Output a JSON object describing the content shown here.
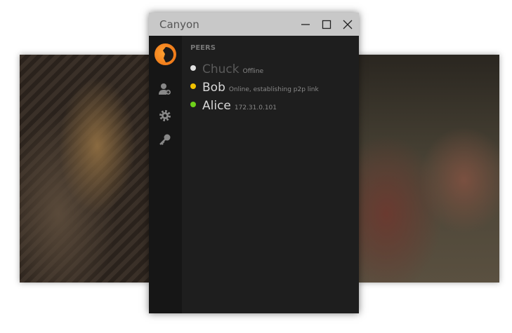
{
  "window": {
    "title": "Canyon"
  },
  "sidebar": {
    "items": [
      "add-peer",
      "settings",
      "keys"
    ]
  },
  "peers": {
    "header": "PEERS",
    "items": [
      {
        "name": "Chuck",
        "status": "Offline",
        "color": "#e0e0e0",
        "name_color": "#5a5a5a"
      },
      {
        "name": "Bob",
        "status": "Online, establishing p2p link",
        "color": "#f2c200",
        "name_color": "#d8d8d8"
      },
      {
        "name": "Alice",
        "status": "172.31.0.101",
        "color": "#6ed01a",
        "name_color": "#d8d8d8"
      }
    ]
  }
}
